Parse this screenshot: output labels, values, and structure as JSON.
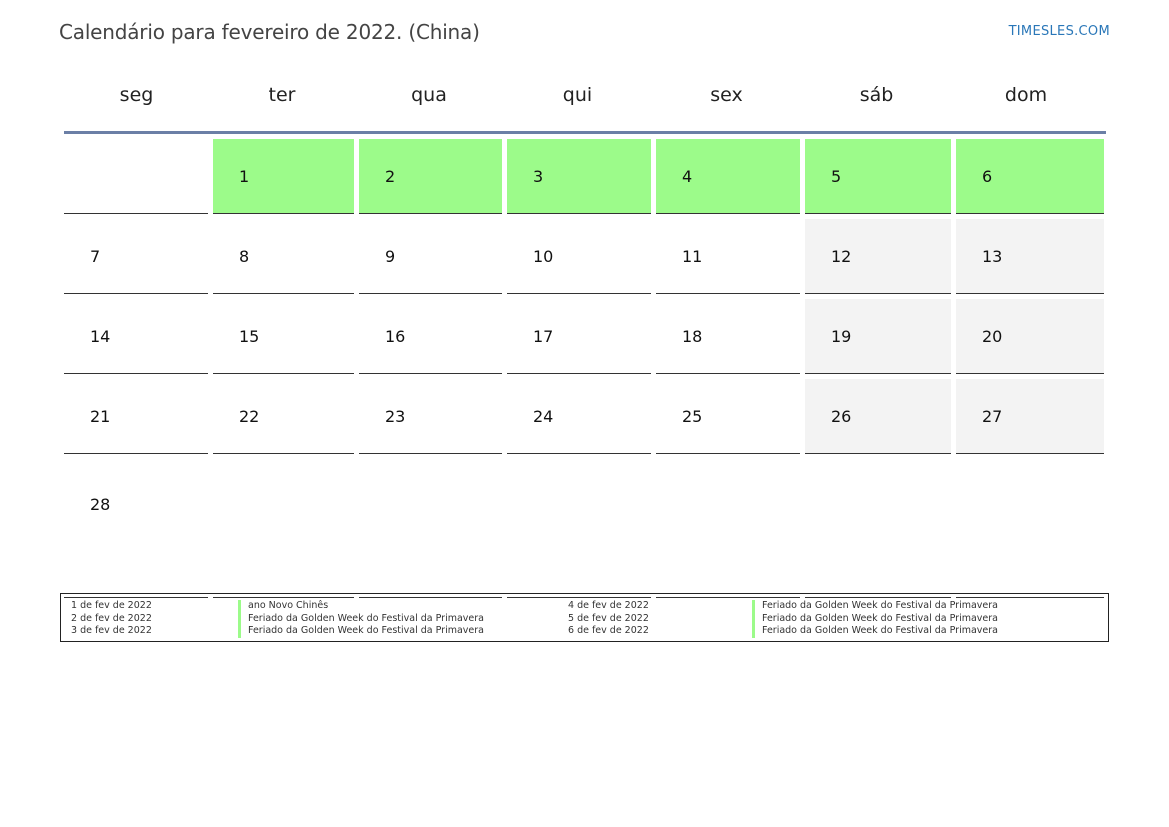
{
  "title": "Calendário para fevereiro de 2022. (China)",
  "brand": "TIMESLES.COM",
  "weekdays": [
    "seg",
    "ter",
    "qua",
    "qui",
    "sex",
    "sáb",
    "dom"
  ],
  "weeks": [
    [
      "",
      "1",
      "2",
      "3",
      "4",
      "5",
      "6"
    ],
    [
      "7",
      "8",
      "9",
      "10",
      "11",
      "12",
      "13"
    ],
    [
      "14",
      "15",
      "16",
      "17",
      "18",
      "19",
      "20"
    ],
    [
      "21",
      "22",
      "23",
      "24",
      "25",
      "26",
      "27"
    ],
    [
      "28",
      "",
      "",
      "",
      "",
      "",
      ""
    ]
  ],
  "colors": {
    "holiday": "#9cfb8a",
    "weekend": "#f3f3f3",
    "header_rule": "#6b7fa6",
    "brand": "#2a77b8"
  },
  "legend": {
    "left_dates": [
      "1 de fev de 2022",
      "2 de fev de 2022",
      "3 de fev de 2022"
    ],
    "left_names": [
      "ano Novo Chinês",
      "Feriado da Golden Week do Festival da Primavera",
      "Feriado da Golden Week do Festival da Primavera"
    ],
    "right_dates": [
      "4 de fev de 2022",
      "5 de fev de 2022",
      "6 de fev de 2022"
    ],
    "right_names": [
      "Feriado da Golden Week do Festival da Primavera",
      "Feriado da Golden Week do Festival da Primavera",
      "Feriado da Golden Week do Festival da Primavera"
    ]
  }
}
